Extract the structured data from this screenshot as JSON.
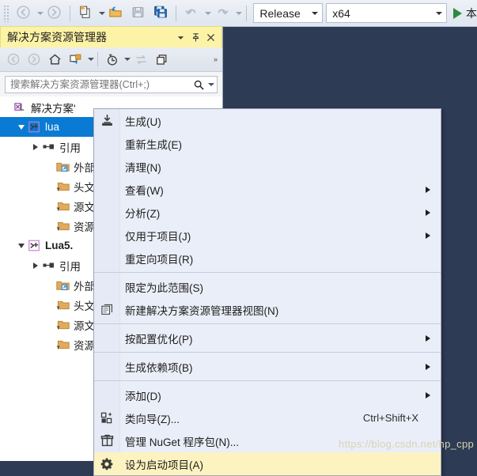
{
  "toolbar": {
    "nav_back_icon": "back-arrow-icon",
    "nav_forward_icon": "forward-arrow-icon",
    "new_item_icon": "new-item-icon",
    "open_file_icon": "open-folder-icon",
    "save_icon": "save-icon",
    "save_all_icon": "save-all-icon",
    "undo_icon": "undo-icon",
    "redo_icon": "redo-icon",
    "configuration": "Release",
    "platform": "x64",
    "run_label": "本",
    "start_icon": "play-icon"
  },
  "solution_explorer": {
    "title": "解决方案资源管理器",
    "title_dropdown_icon": "chevron-down-icon",
    "pin_icon": "pin-icon",
    "close_icon": "close-icon",
    "toolbar": {
      "back_icon": "back-arrow-icon",
      "forward_icon": "forward-arrow-icon",
      "home_icon": "home-icon",
      "sync_icon": "sync-with-active-document-icon",
      "pending_changes_icon": "pending-changes-filter-icon",
      "refresh_icon": "refresh-icon",
      "collapse_all_icon": "collapse-all-icon",
      "overflow": "»"
    },
    "search_placeholder": "搜索解决方案资源管理器(Ctrl+;)",
    "search_value": "",
    "search_icon": "search-icon",
    "search_dropdown_icon": "chevron-down-icon",
    "tree": [
      {
        "label": "解决方案'",
        "icon": "solution-icon",
        "indent": 0,
        "expander": "none",
        "selected": false,
        "bold": false
      },
      {
        "label": "lua",
        "icon": "cpp-project-icon",
        "indent": 1,
        "expander": "open",
        "selected": true,
        "bold": false
      },
      {
        "label": "引用",
        "icon": "references-icon",
        "indent": 2,
        "expander": "closed",
        "selected": false,
        "bold": false
      },
      {
        "label": "外部",
        "icon": "external-dependencies-folder-icon",
        "indent": 3,
        "expander": "none",
        "selected": false,
        "bold": false
      },
      {
        "label": "头文",
        "icon": "filter-folder-icon",
        "indent": 3,
        "expander": "none",
        "selected": false,
        "bold": false
      },
      {
        "label": "源文",
        "icon": "filter-folder-icon",
        "indent": 3,
        "expander": "none",
        "selected": false,
        "bold": false
      },
      {
        "label": "资源",
        "icon": "filter-folder-icon",
        "indent": 3,
        "expander": "none",
        "selected": false,
        "bold": false
      },
      {
        "label": "Lua5.",
        "icon": "cpp-project-icon",
        "indent": 1,
        "expander": "open",
        "selected": false,
        "bold": true
      },
      {
        "label": "引用",
        "icon": "references-icon",
        "indent": 2,
        "expander": "closed",
        "selected": false,
        "bold": false
      },
      {
        "label": "外部",
        "icon": "external-dependencies-folder-icon",
        "indent": 3,
        "expander": "none",
        "selected": false,
        "bold": false
      },
      {
        "label": "头文",
        "icon": "filter-folder-icon",
        "indent": 3,
        "expander": "none",
        "selected": false,
        "bold": false
      },
      {
        "label": "源文",
        "icon": "filter-folder-icon",
        "indent": 3,
        "expander": "none",
        "selected": false,
        "bold": false
      },
      {
        "label": "资源",
        "icon": "filter-folder-icon",
        "indent": 3,
        "expander": "none",
        "selected": false,
        "bold": false
      }
    ]
  },
  "context_menu": {
    "items": [
      {
        "label": "生成(U)",
        "icon": "build-icon",
        "submenu": false,
        "shortcut": "",
        "highlighted": false,
        "separator_after": false
      },
      {
        "label": "重新生成(E)",
        "icon": "",
        "submenu": false,
        "shortcut": "",
        "highlighted": false,
        "separator_after": false
      },
      {
        "label": "清理(N)",
        "icon": "",
        "submenu": false,
        "shortcut": "",
        "highlighted": false,
        "separator_after": false
      },
      {
        "label": "查看(W)",
        "icon": "",
        "submenu": true,
        "shortcut": "",
        "highlighted": false,
        "separator_after": false
      },
      {
        "label": "分析(Z)",
        "icon": "",
        "submenu": true,
        "shortcut": "",
        "highlighted": false,
        "separator_after": false
      },
      {
        "label": "仅用于项目(J)",
        "icon": "",
        "submenu": true,
        "shortcut": "",
        "highlighted": false,
        "separator_after": false
      },
      {
        "label": "重定向项目(R)",
        "icon": "",
        "submenu": false,
        "shortcut": "",
        "highlighted": false,
        "separator_after": true
      },
      {
        "label": "限定为此范围(S)",
        "icon": "",
        "submenu": false,
        "shortcut": "",
        "highlighted": false,
        "separator_after": false
      },
      {
        "label": "新建解决方案资源管理器视图(N)",
        "icon": "new-solution-explorer-view-icon",
        "submenu": false,
        "shortcut": "",
        "highlighted": false,
        "separator_after": true
      },
      {
        "label": "按配置优化(P)",
        "icon": "",
        "submenu": true,
        "shortcut": "",
        "highlighted": false,
        "separator_after": true
      },
      {
        "label": "生成依赖项(B)",
        "icon": "",
        "submenu": true,
        "shortcut": "",
        "highlighted": false,
        "separator_after": true
      },
      {
        "label": "添加(D)",
        "icon": "",
        "submenu": true,
        "shortcut": "",
        "highlighted": false,
        "separator_after": false
      },
      {
        "label": "类向导(Z)...",
        "icon": "class-wizard-icon",
        "submenu": false,
        "shortcut": "Ctrl+Shift+X",
        "highlighted": false,
        "separator_after": false
      },
      {
        "label": "管理 NuGet 程序包(N)...",
        "icon": "nuget-icon",
        "submenu": false,
        "shortcut": "",
        "highlighted": false,
        "separator_after": false
      },
      {
        "label": "设为启动项目(A)",
        "icon": "gear-icon",
        "submenu": false,
        "shortcut": "",
        "highlighted": true,
        "separator_after": false
      }
    ]
  },
  "watermark": "https://blog.csdn.net/hp_cpp",
  "colors": {
    "background": "#2d3b55",
    "menu_bg": "#eaeef8",
    "menu_highlight": "#fdf3c0",
    "title_highlight": "#fdf3a6",
    "tree_selection": "#0a7bd4",
    "start_green": "#2e8b3d"
  }
}
